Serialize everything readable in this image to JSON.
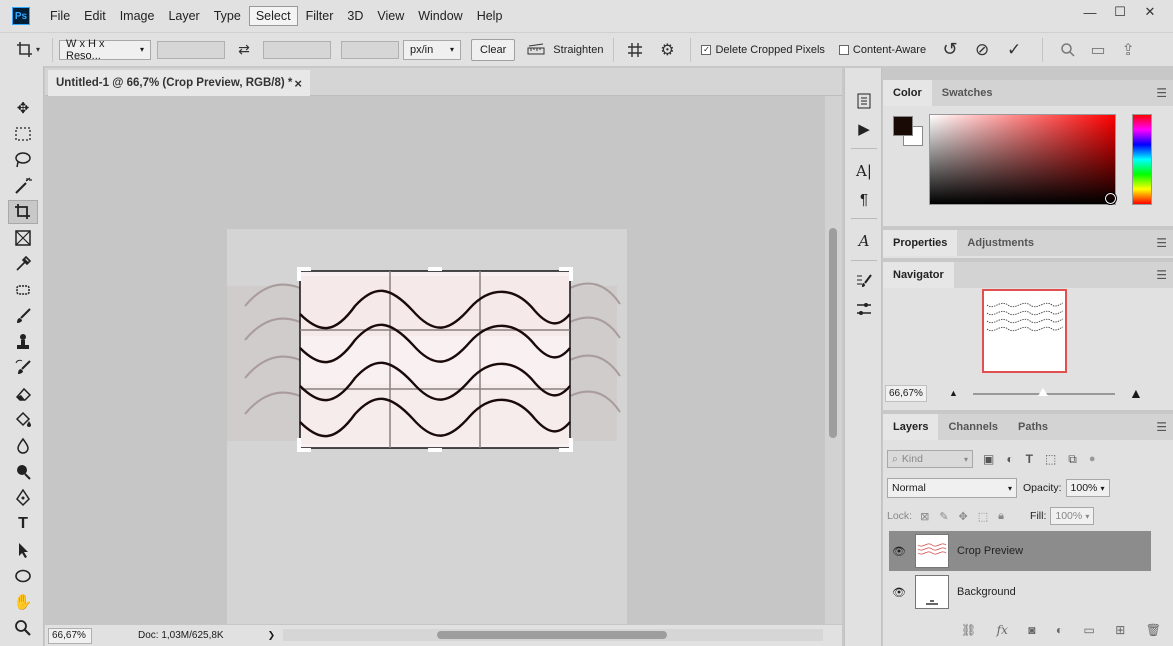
{
  "app": {
    "logo": "Ps"
  },
  "menu": {
    "items": [
      "File",
      "Edit",
      "Image",
      "Layer",
      "Type",
      "Select",
      "Filter",
      "3D",
      "View",
      "Window",
      "Help"
    ],
    "active": "Select"
  },
  "window_controls": {
    "minimize": "—",
    "maximize": "☐",
    "close": "✕"
  },
  "options_bar": {
    "ratio_select": "W x H x Reso...",
    "units_select": "px/in",
    "clear_label": "Clear",
    "straighten_label": "Straighten",
    "delete_cropped_label": "Delete Cropped Pixels",
    "delete_cropped_checked": true,
    "content_aware_label": "Content-Aware",
    "content_aware_checked": false
  },
  "document": {
    "tab_title": "Untitled-1 @ 66,7% (Crop Preview, RGB/8) *",
    "tab_close": "×",
    "status_zoom": "66,67%",
    "status_doc": "Doc: 1,03M/625,8K",
    "status_arrow": "❯"
  },
  "color_panel": {
    "tabs": [
      "Color",
      "Swatches"
    ],
    "foreground": "#1a0a05",
    "background": "#ffffff"
  },
  "properties_panel": {
    "tabs": [
      "Properties",
      "Adjustments"
    ]
  },
  "navigator_panel": {
    "tabs": [
      "Navigator"
    ],
    "zoom": "66,67%"
  },
  "layers_panel": {
    "tabs": [
      "Layers",
      "Channels",
      "Paths"
    ],
    "filter_placeholder": "Kind",
    "blend_mode": "Normal",
    "opacity_label": "Opacity:",
    "opacity_value": "100%",
    "lock_label": "Lock:",
    "fill_label": "Fill:",
    "fill_value": "100%",
    "layers": [
      {
        "name": "Crop Preview",
        "selected": true,
        "visible": true
      },
      {
        "name": "Background",
        "selected": false,
        "visible": true
      }
    ]
  },
  "colors": {
    "accent_red": "#e05050",
    "selected_layer": "#8c8c8c"
  }
}
